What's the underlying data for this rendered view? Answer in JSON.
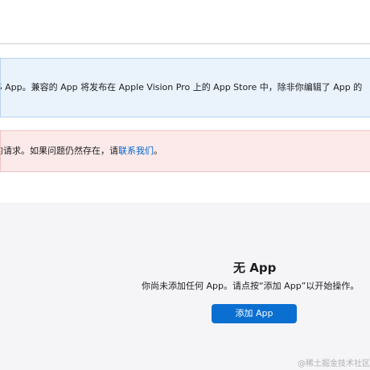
{
  "info_banner": {
    "text": "OS App。兼容的 App 将发布在 Apple Vision Pro 上的 App Store 中，除非你编辑了 App 的"
  },
  "error_banner": {
    "text": "的请求。如果问题仍然存在，请",
    "link": "联系我们",
    "suffix": "。"
  },
  "empty_state": {
    "title": "无 App",
    "description": "你尚未添加任何 App。请点按“添加 App”以开始操作。",
    "button_label": "添加 App"
  },
  "watermark": "@稀土掘金技术社区",
  "colors": {
    "accent": "#0a6fd1",
    "info_bg": "#eaf3fc",
    "error_bg": "#fceaea"
  }
}
